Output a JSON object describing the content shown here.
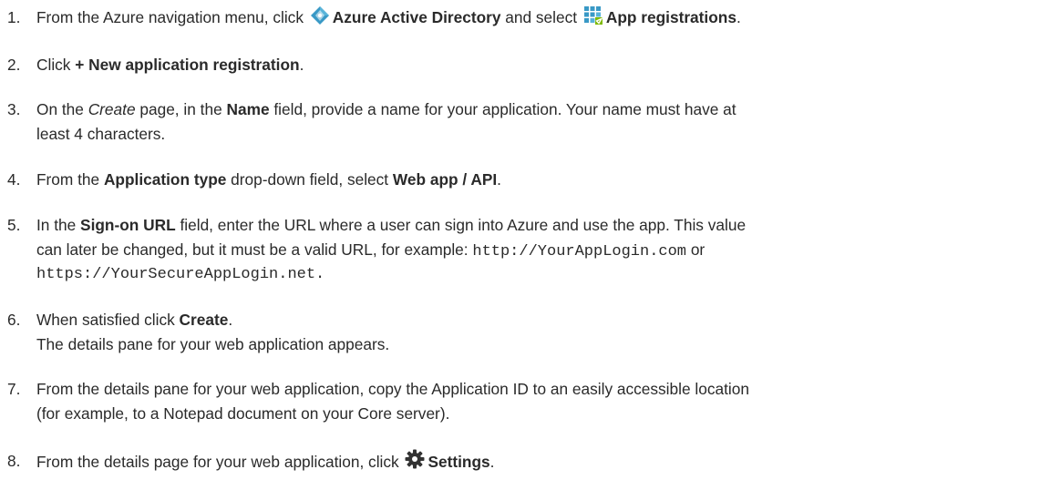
{
  "steps": [
    {
      "number": "1.",
      "t1": "From the Azure navigation menu, click ",
      "aad_icon": "azure-active-directory-icon",
      "b1": "Azure Active Directory",
      "t2": " and select ",
      "app_icon": "app-registrations-icon",
      "b2": "App registrations",
      "t3": "."
    },
    {
      "number": "2.",
      "t1": "Click ",
      "b1": "+ New application registration",
      "t2": "."
    },
    {
      "number": "3.",
      "t1": "On the ",
      "i1": "Create",
      "t2": " page, in the ",
      "b1": "Name",
      "t3": " field, provide a name for your application. Your name must have at",
      "t4": "least 4 characters."
    },
    {
      "number": "4.",
      "t1": "From the ",
      "b1": "Application type",
      "t2": " drop-down field, select ",
      "b2": "Web app / API",
      "t3": "."
    },
    {
      "number": "5.",
      "t1": "In the ",
      "b1": "Sign-on URL",
      "t2": " field, enter the URL where a user can sign into Azure and use the app. This value",
      "t3": "can later be changed, but it must be a valid URL, for example: ",
      "code1": "http://YourAppLogin.com",
      "t4": " or",
      "code2": "https://YourSecureAppLogin.net."
    },
    {
      "number": "6.",
      "t1": "When satisfied click ",
      "b1": "Create",
      "t2": ".",
      "t3": "The details pane for your web application appears."
    },
    {
      "number": "7.",
      "t1": "From the details pane for your web application, copy the Application ID to an easily accessible location",
      "t2": "(for example, to a Notepad document on your Core server)."
    },
    {
      "number": "8.",
      "t1": "From the details page for your web application, click ",
      "gear_icon": "gear-icon",
      "b1": "Settings",
      "t2": "."
    }
  ],
  "colors": {
    "text": "#2a2a2a",
    "azure_blue": "#3999c6",
    "azure_light": "#59b4d9",
    "gear": "#333333"
  }
}
